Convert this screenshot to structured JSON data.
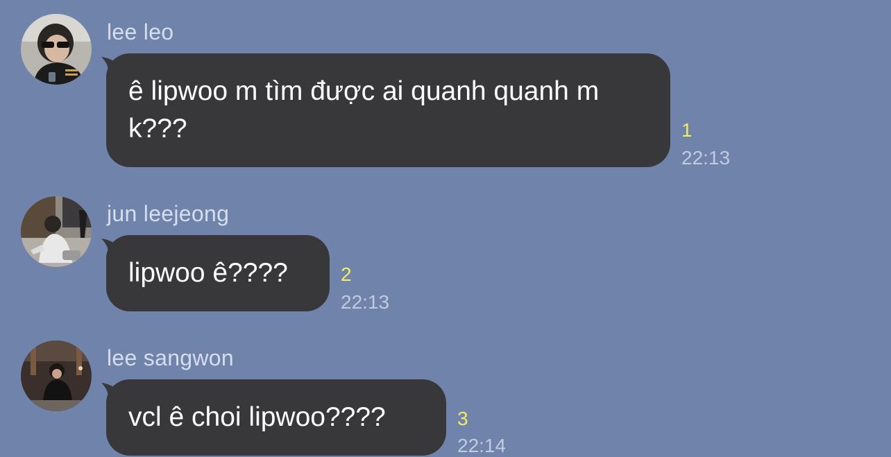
{
  "chat": {
    "background_color": "#6f83ab",
    "bubble_color": "#38383b",
    "read_count_color": "#f5ec5f",
    "messages": [
      {
        "sender": "lee leo",
        "text": "ê lipwoo m tìm được ai quanh quanh m k???",
        "read_count": "1",
        "time": "22:13",
        "avatar_icon": "profile-photo-sunglasses-icon"
      },
      {
        "sender": "jun leejeong",
        "text": "lipwoo ê????",
        "read_count": "2",
        "time": "22:13",
        "avatar_icon": "profile-photo-sitting-icon"
      },
      {
        "sender": "lee sangwon",
        "text": "vcl ê choi lipwoo????",
        "read_count": "3",
        "time": "22:14",
        "avatar_icon": "profile-photo-dark-icon"
      }
    ]
  }
}
